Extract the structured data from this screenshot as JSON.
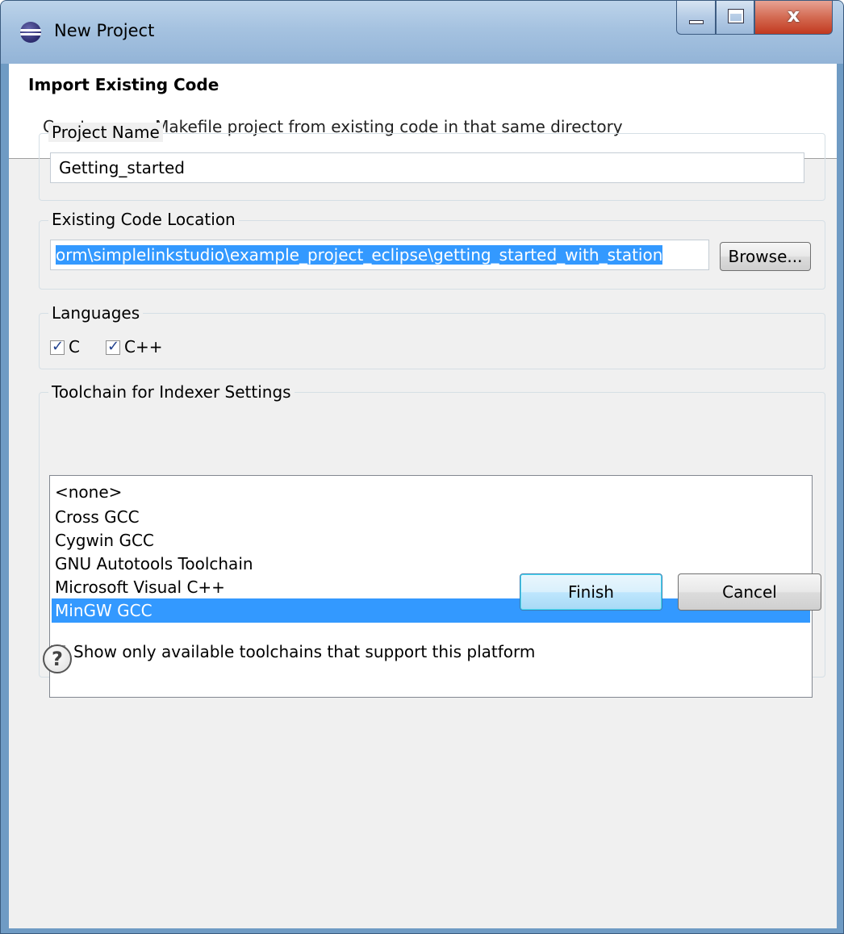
{
  "window": {
    "title": "New Project",
    "close_glyph": "x",
    "icon": "eclipse-icon"
  },
  "header": {
    "title": "Import Existing Code",
    "description": "Create a new Makefile project from existing code in that same directory"
  },
  "project_name": {
    "label": "Project Name",
    "value": "Getting_started"
  },
  "code_location": {
    "label": "Existing Code Location",
    "value": "orm\\simplelinkstudio\\example_project_eclipse\\getting_started_with_station",
    "browse_label": "Browse..."
  },
  "languages": {
    "label": "Languages",
    "options": [
      {
        "label": "C",
        "checked": true
      },
      {
        "label": "C++",
        "checked": true
      }
    ]
  },
  "toolchain": {
    "label": "Toolchain for Indexer Settings",
    "items": [
      "<none>",
      "Cross GCC",
      "Cygwin GCC",
      "GNU Autotools Toolchain",
      "Microsoft Visual C++",
      "MinGW GCC"
    ],
    "selected_index": 5,
    "show_only_label": "Show only available toolchains that support this platform",
    "show_only_checked": true
  },
  "footer": {
    "help_glyph": "?",
    "finish_label": "Finish",
    "cancel_label": "Cancel"
  },
  "colors": {
    "selection": "#3399ff",
    "titlebar": "#a5c2e0",
    "close_button": "#c2391f"
  }
}
